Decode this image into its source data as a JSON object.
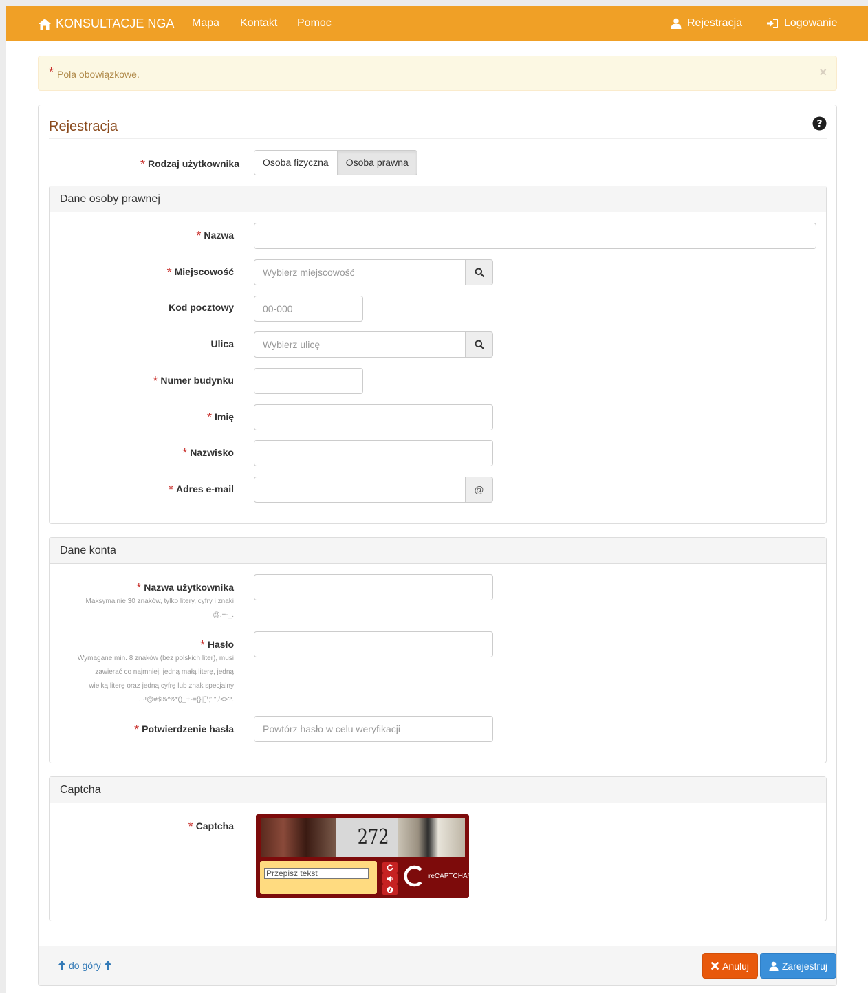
{
  "nav": {
    "brand": "KONSULTACJE NGA",
    "links": [
      "Mapa",
      "Kontakt",
      "Pomoc"
    ],
    "register": "Rejestracja",
    "login": "Logowanie"
  },
  "alert": {
    "star": "*",
    "text": "Pola obowiązkowe.",
    "close": "×"
  },
  "form": {
    "title": "Rejestracja",
    "user_type_label": "Rodzaj użytkownika",
    "user_type_options": [
      "Osoba fizyczna",
      "Osoba prawna"
    ],
    "user_type_selected": "Osoba prawna",
    "legal_section": {
      "heading": "Dane osoby prawnej",
      "nazwa_label": "Nazwa",
      "miejscowosc_label": "Miejscowość",
      "miejscowosc_placeholder": "Wybierz miejscowość",
      "kod_label": "Kod pocztowy",
      "kod_placeholder": "00-000",
      "ulica_label": "Ulica",
      "ulica_placeholder": "Wybierz ulicę",
      "numer_label": "Numer budynku",
      "imie_label": "Imię",
      "nazwisko_label": "Nazwisko",
      "email_label": "Adres e-mail",
      "email_addon": "@"
    },
    "account_section": {
      "heading": "Dane konta",
      "username_label": "Nazwa użytkownika",
      "username_hint": [
        "Maksymalnie 30 znaków, tylko litery, cyfry i znaki",
        "@.+-_."
      ],
      "password_label": "Hasło",
      "password_hint": [
        "Wymagane min. 8 znaków (bez polskich liter), musi",
        "zawierać co najmniej: jedną małą literę, jedną",
        "wielką literę oraz jedną cyfrę lub znak specjalny",
        ".~!@#$%^&*()_+-={}|[]\\;':\",/<>?."
      ],
      "confirm_label": "Potwierdzenie hasła",
      "confirm_placeholder": "Powtórz hasło w celu weryfikacji"
    },
    "captcha_section": {
      "heading": "Captcha",
      "label": "Captcha",
      "image_text": "272",
      "input_placeholder": "Przepisz tekst",
      "logo_text": "reCAPTCHA™"
    }
  },
  "footer": {
    "to_top": "do góry",
    "cancel": "Anuluj",
    "register": "Zarejestruj"
  },
  "colors": {
    "navbar": "#f0a026",
    "title": "#8a4a1c",
    "required": "#c9302c",
    "cancel": "#e8590c",
    "register": "#3a8fd9"
  },
  "icons": [
    "home-icon",
    "user-icon",
    "login-icon",
    "question-circle-icon",
    "search-icon",
    "refresh-icon",
    "audio-icon",
    "help-icon",
    "times-icon",
    "arrow-up-icon"
  ]
}
